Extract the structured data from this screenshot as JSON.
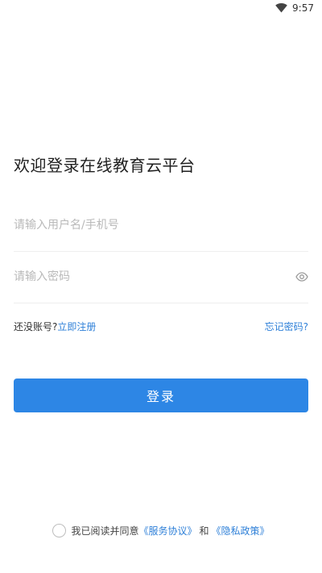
{
  "status_bar": {
    "time": "9:57"
  },
  "title": "欢迎登录在线教育云平台",
  "username": {
    "placeholder": "请输入用户名/手机号",
    "value": ""
  },
  "password": {
    "placeholder": "请输入密码",
    "value": ""
  },
  "links": {
    "no_account": "还没账号?",
    "register": "立即注册",
    "forgot": "忘记密码?"
  },
  "login_button": "登录",
  "agreement": {
    "prefix": "我已阅读并同意",
    "service": "《服务协议》",
    "and": "和",
    "privacy": "《隐私政策》"
  },
  "colors": {
    "accent": "#2d86e5",
    "link": "#2f80d8"
  },
  "icons": {
    "wifi": "wifi-icon",
    "eye": "eye-icon"
  }
}
